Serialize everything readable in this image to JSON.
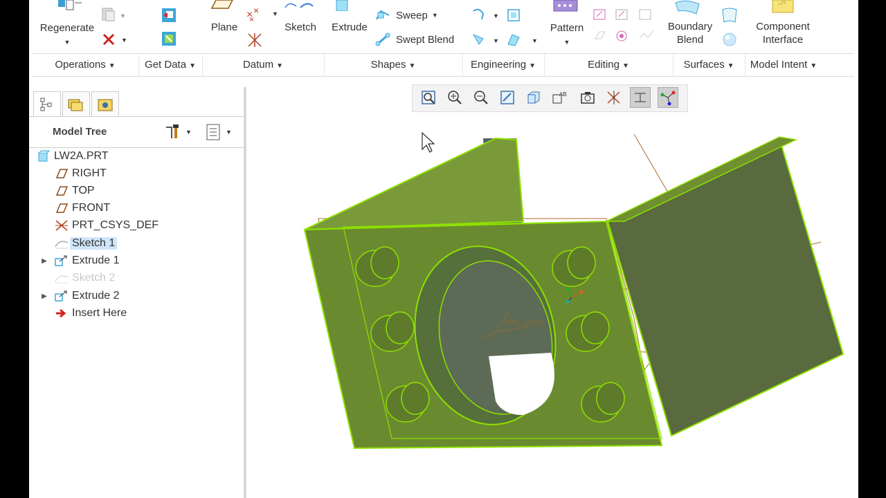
{
  "ribbon": {
    "regenerate_label": "Regenerate",
    "plane_label": "Plane",
    "sketch_label": "Sketch",
    "extrude_label": "Extrude",
    "sweep_label": "Sweep",
    "swept_blend_label": "Swept Blend",
    "pattern_label": "Pattern",
    "boundary_blend_label_1": "Boundary",
    "boundary_blend_label_2": "Blend",
    "component_interface_label_1": "Component",
    "component_interface_label_2": "Interface",
    "groups": [
      "Operations",
      "Get Data",
      "Datum",
      "Shapes",
      "Engineering",
      "Editing",
      "Surfaces",
      "Model Intent"
    ]
  },
  "model_tree": {
    "title": "Model Tree",
    "items": [
      {
        "label": "LW2A.PRT",
        "icon": "part-icon"
      },
      {
        "label": "RIGHT",
        "icon": "datum-plane-icon"
      },
      {
        "label": "TOP",
        "icon": "datum-plane-icon"
      },
      {
        "label": "FRONT",
        "icon": "datum-plane-icon"
      },
      {
        "label": "PRT_CSYS_DEF",
        "icon": "csys-icon"
      },
      {
        "label": "Sketch 1",
        "icon": "sketch-icon",
        "selected": true
      },
      {
        "label": "Extrude 1",
        "icon": "extrude-icon",
        "expandable": true
      },
      {
        "label": "Sketch 2",
        "icon": "sketch-icon",
        "dimmed": true
      },
      {
        "label": "Extrude 2",
        "icon": "extrude-icon",
        "expandable": true
      },
      {
        "label": "Insert Here",
        "icon": "insert-arrow-icon"
      }
    ]
  },
  "viewport": {
    "csys_label": "PRT_CSYS"
  },
  "colors": {
    "highlight_green": "#8ee000",
    "model_fill": "#6b8f2a",
    "datum_orange": "#b06a2a",
    "selection_blue": "#cfe5fb"
  }
}
